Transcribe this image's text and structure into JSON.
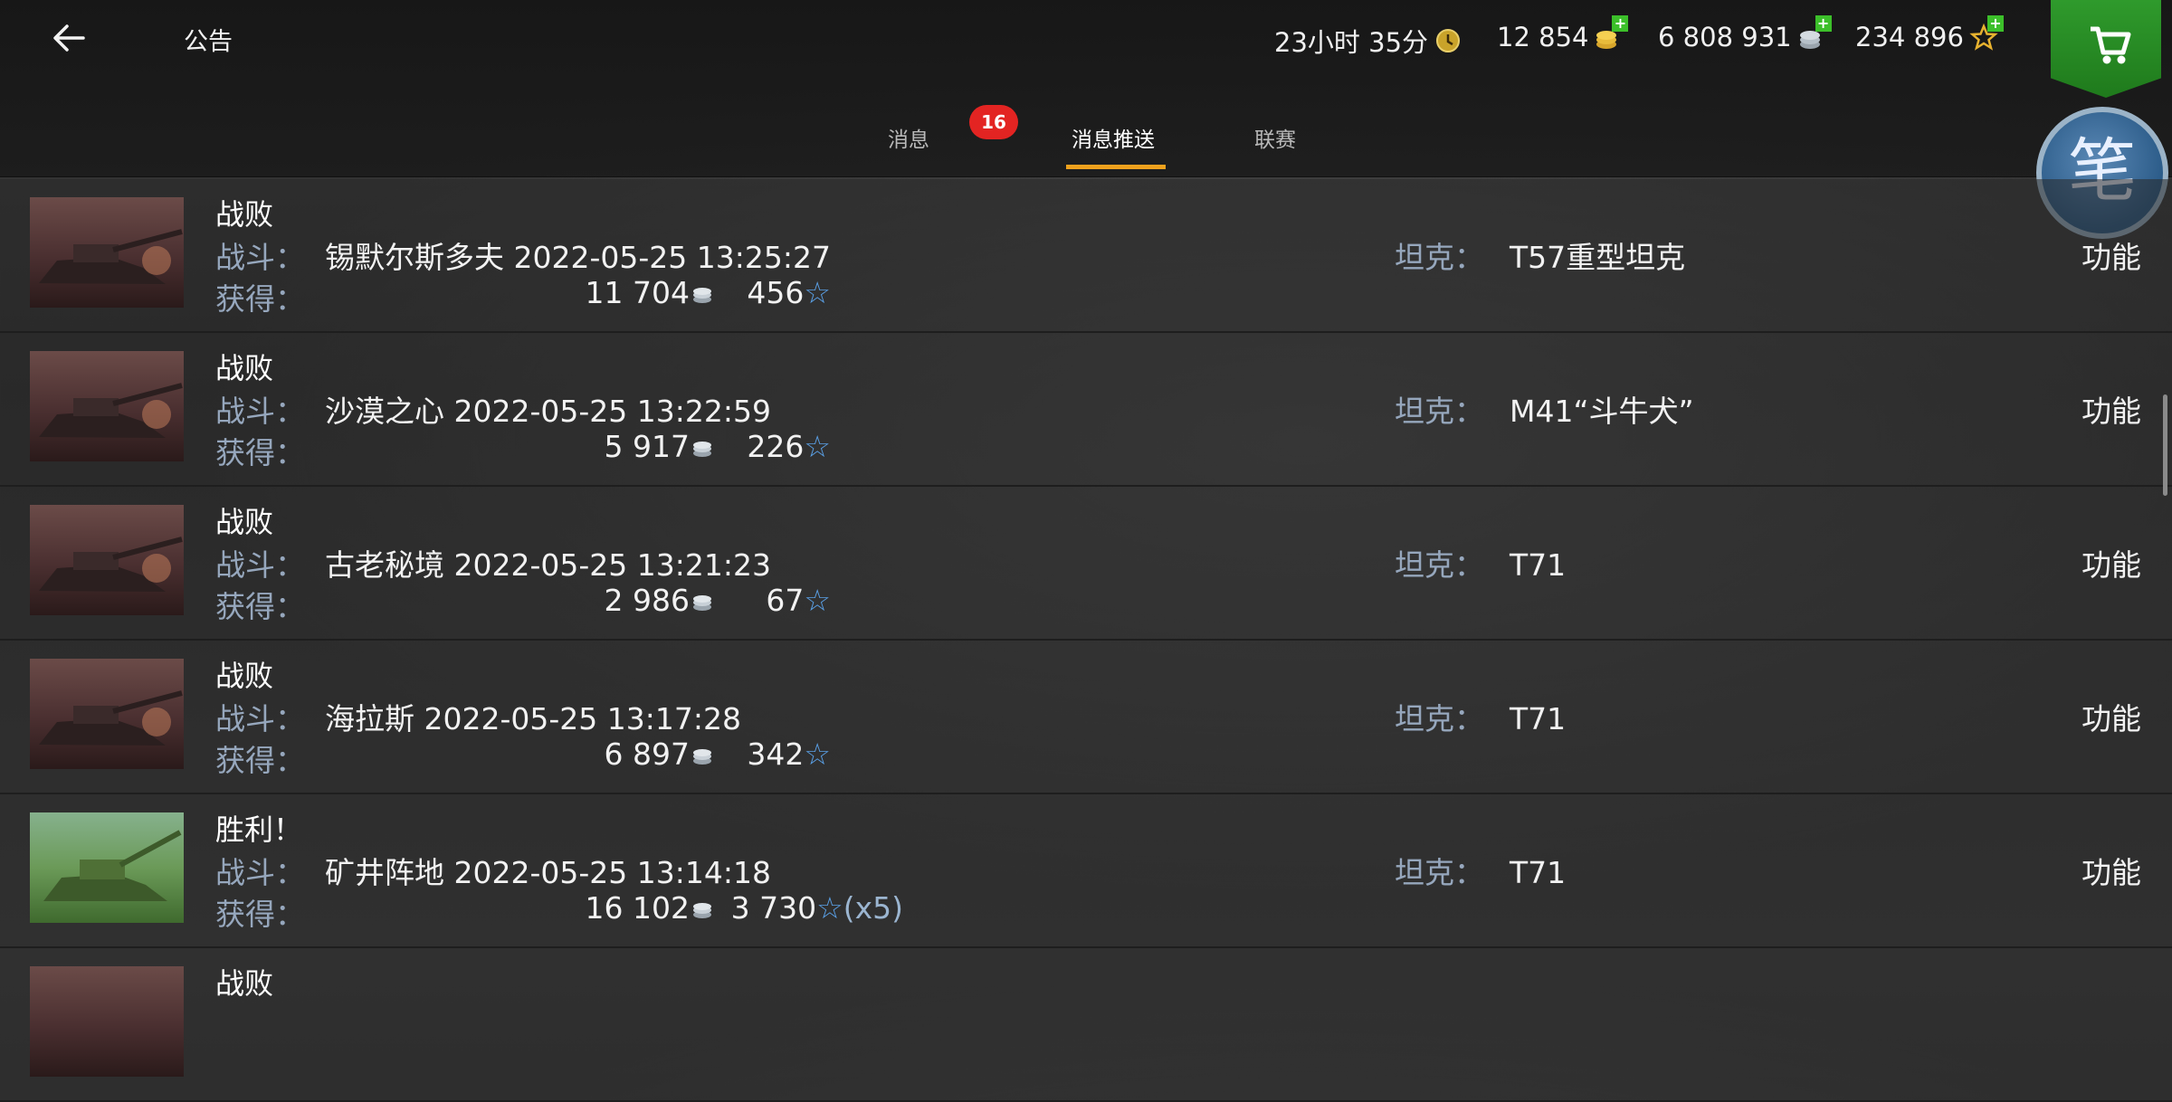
{
  "header": {
    "title": "公告",
    "timer": "23小时 35分",
    "gold": "12 854",
    "silver": "6 808 931",
    "free_xp": "234 896"
  },
  "tabs": [
    {
      "label": "消息",
      "badge": "16"
    },
    {
      "label": "消息推送",
      "active": true
    },
    {
      "label": "联赛"
    }
  ],
  "labels": {
    "battle": "战斗：",
    "reward": "获得：",
    "tank": "坦克：",
    "function": "功能"
  },
  "messages": [
    {
      "result": "战败",
      "map": "锡默尔斯多夫 2022-05-25 13:25:27",
      "silver": "11 704",
      "xp": "456",
      "tank": "T57重型坦克",
      "type": "defeat"
    },
    {
      "result": "战败",
      "map": "沙漠之心 2022-05-25 13:22:59",
      "silver": "5 917",
      "xp": "226",
      "tank": "M41“斗牛犬”",
      "type": "defeat"
    },
    {
      "result": "战败",
      "map": "古老秘境 2022-05-25 13:21:23",
      "silver": "2 986",
      "xp": "67",
      "tank": "T71",
      "type": "defeat"
    },
    {
      "result": "战败",
      "map": "海拉斯 2022-05-25 13:17:28",
      "silver": "6 897",
      "xp": "342",
      "tank": "T71",
      "type": "defeat"
    },
    {
      "result": "胜利！",
      "map": "矿井阵地 2022-05-25 13:14:18",
      "silver": "16 102",
      "xp": "3 730",
      "xp_mult": "(x5)",
      "tank": "T71",
      "type": "victory"
    },
    {
      "result": "战败",
      "type": "defeat"
    }
  ],
  "colors": {
    "accent": "#f0a21d",
    "badge": "#e32422",
    "label": "#96a7bd",
    "star": "#5aa0e6",
    "shop": "#2f9a2c"
  },
  "icons": {
    "back": "arrow-left-icon",
    "timer": "premium-clock-icon",
    "gold": "gold-coins-icon",
    "silver": "silver-coins-icon",
    "xp": "free-xp-star-icon",
    "shop": "shopping-cart-icon"
  }
}
